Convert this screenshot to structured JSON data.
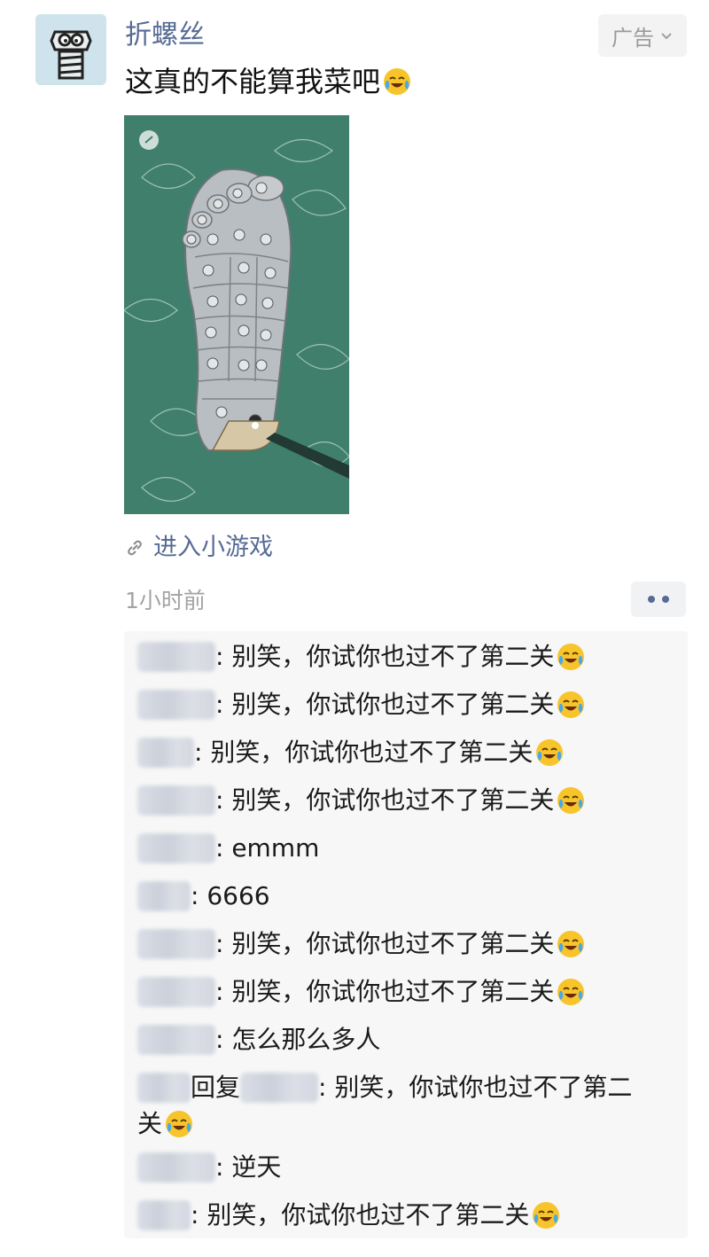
{
  "post": {
    "author": "折螺丝",
    "ad_label": "广告",
    "text": "这真的不能算我菜吧",
    "game_link": "进入小游戏",
    "time": "1小时前"
  },
  "comments": [
    {
      "text": ": 别笑，你试你也过不了第二关",
      "emoji": true
    },
    {
      "text": ": 别笑，你试你也过不了第二关",
      "emoji": true
    },
    {
      "text": ": 别笑，你试你也过不了第二关",
      "emoji": true
    },
    {
      "text": ": 别笑，你试你也过不了第二关",
      "emoji": true
    },
    {
      "text": ": emmm",
      "emoji": false
    },
    {
      "text": ": 6666",
      "emoji": false
    },
    {
      "text": ": 别笑，你试你也过不了第二关",
      "emoji": true
    },
    {
      "text": ": 别笑，你试你也过不了第二关",
      "emoji": true
    },
    {
      "text": ": 怎么那么多人",
      "emoji": false
    },
    {
      "reply_word": "回复",
      "text_line1": ": 别笑，你试你也过不了第二",
      "text_line2": "关",
      "emoji": true
    },
    {
      "text": ": 逆天",
      "emoji": false
    },
    {
      "text": ": 别笑，你试你也过不了第二关",
      "emoji": true
    }
  ],
  "colors": {
    "link": "#576b95",
    "muted": "#a3a3a3",
    "comment_bg": "#f7f7f7",
    "image_bg": "#3f7f6c"
  },
  "icons": [
    "bolt-avatar-icon",
    "chevron-down-icon",
    "laugh-cry-emoji",
    "link-icon",
    "more-dots-icon"
  ]
}
